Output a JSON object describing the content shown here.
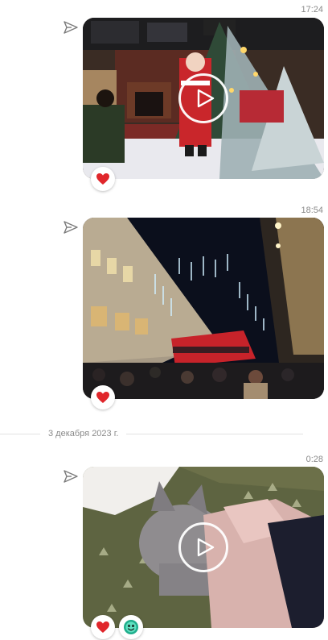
{
  "messages": [
    {
      "time": "17:24",
      "type": "video",
      "reactions": [
        "heart"
      ]
    },
    {
      "time": "18:54",
      "type": "photo",
      "reactions": [
        "heart"
      ]
    },
    {
      "time": "0:28",
      "type": "video",
      "reactions": [
        "heart",
        "smiling-face"
      ]
    }
  ],
  "date_separator": "3 декабря 2023 г.",
  "icons": {
    "share": "share-arrow-icon",
    "play": "play-icon",
    "heart": "heart-icon",
    "emoji": "smiling-face-icon"
  },
  "colors": {
    "heart": "#e0262b",
    "emoji": "#1fae8c",
    "meta_text": "#8a8a8a"
  }
}
